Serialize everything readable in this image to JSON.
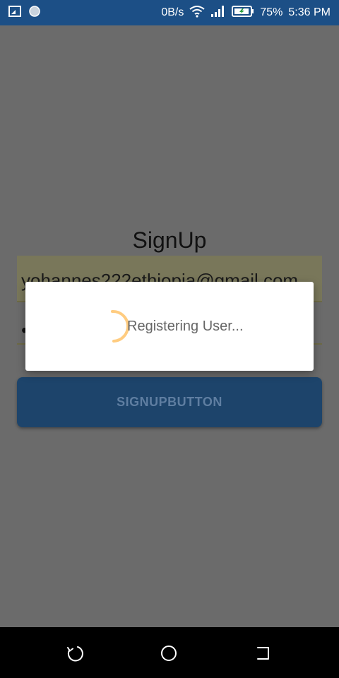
{
  "status_bar": {
    "left_icons": [
      "screenshot-icon",
      "circle-notification-icon"
    ],
    "network_speed": "0B/s",
    "icons": [
      "wifi-icon",
      "signal-icon",
      "battery-charging-icon"
    ],
    "battery_percent": "75%",
    "time": "5:36 PM",
    "background_color": "#1c4f86"
  },
  "form": {
    "title": "SignUp",
    "email_value": "yohannes222ethiopia@gmail.com",
    "password_value": "•",
    "signup_button_label": "SIGNUPBUTTON"
  },
  "dialog": {
    "message": "Registering User...",
    "spinner_color": "#ffcc80"
  },
  "nav_bar": {
    "icons": [
      "back-icon",
      "home-icon",
      "recent-apps-icon"
    ]
  }
}
